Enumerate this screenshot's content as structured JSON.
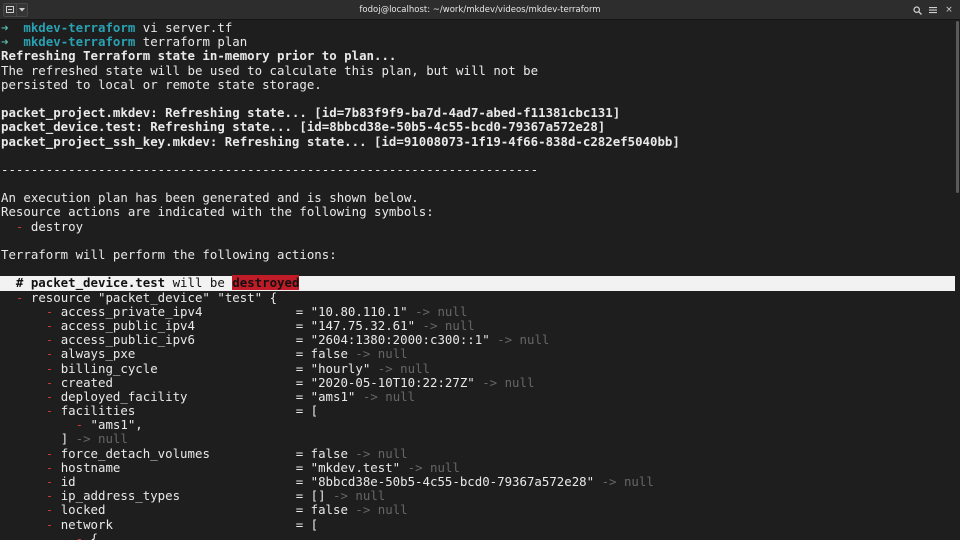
{
  "window": {
    "title": "fodoj@localhost: ~/work/mkdev/videos/mkdev-terraform",
    "new_tab_icon": "new-tab-icon",
    "menu_dropdown_icon": "chevron-down-icon",
    "search_icon": "search-icon",
    "hamburger_icon": "hamburger-menu-icon",
    "close_icon": "close-icon",
    "close_glyph": "×"
  },
  "terminal": {
    "prompt_arrow": "➜",
    "cmd1": {
      "dir": "mkdev-terraform",
      "command": "vi server.tf"
    },
    "cmd2": {
      "dir": "mkdev-terraform",
      "command": "terraform plan"
    },
    "refresh_heading": "Refreshing Terraform state in-memory prior to plan...",
    "refresh_note_1": "The refreshed state will be used to calculate this plan, but will not be",
    "refresh_note_2": "persisted to local or remote state storage.",
    "refresh_1": "packet_project.mkdev: Refreshing state... [id=7b83f9f9-ba7d-4ad7-abed-f11381cbc131]",
    "refresh_2": "packet_device.test: Refreshing state... [id=8bbcd38e-50b5-4c55-bcd0-79367a572e28]",
    "refresh_3": "packet_project_ssh_key.mkdev: Refreshing state... [id=91008073-1f19-4f66-838d-c282ef5040bb]",
    "separator": "------------------------------------------------------------------------",
    "plan_1": "An execution plan has been generated and is shown below.",
    "plan_2": "Resource actions are indicated with the following symbols:",
    "symbol_minus": "-",
    "symbol_label": "destroy",
    "perform": "Terraform will perform the following actions:",
    "resource_comment_prefix": "# packet_device.test",
    "resource_comment_mid": "will be",
    "resource_comment_action": "destroyed",
    "resource_decl": "resource \"packet_device\" \"test\" {",
    "arrow_null": "-> null",
    "attrs": [
      {
        "key": "access_private_ipv4",
        "value": "\"10.80.110.1\""
      },
      {
        "key": "access_public_ipv4",
        "value": "\"147.75.32.61\""
      },
      {
        "key": "access_public_ipv6",
        "value": "\"2604:1380:2000:c300::1\""
      },
      {
        "key": "always_pxe",
        "value": "false"
      },
      {
        "key": "billing_cycle",
        "value": "\"hourly\""
      },
      {
        "key": "created",
        "value": "\"2020-05-10T10:22:27Z\""
      },
      {
        "key": "deployed_facility",
        "value": "\"ams1\""
      },
      {
        "key": "facilities",
        "value": "["
      },
      {
        "key": "force_detach_volumes",
        "value": "false"
      },
      {
        "key": "hostname",
        "value": "\"mkdev.test\""
      },
      {
        "key": "id",
        "value": "\"8bbcd38e-50b5-4c55-bcd0-79367a572e28\""
      },
      {
        "key": "ip_address_types",
        "value": "[]"
      },
      {
        "key": "locked",
        "value": "false"
      },
      {
        "key": "network",
        "value": "["
      }
    ],
    "facility_item": "\"ams1\",",
    "list_close": "]",
    "brace_open": "{"
  }
}
